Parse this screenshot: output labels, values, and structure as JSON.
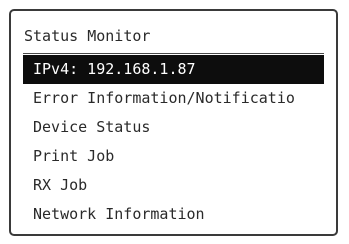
{
  "screen": {
    "title": "Status Monitor",
    "menu": [
      {
        "label": "IPv4: 192.168.1.87",
        "selected": true
      },
      {
        "label": "Error Information/Notificatio",
        "selected": false
      },
      {
        "label": "Device Status",
        "selected": false
      },
      {
        "label": "Print Job",
        "selected": false
      },
      {
        "label": "RX Job",
        "selected": false
      },
      {
        "label": "Network Information",
        "selected": false
      }
    ]
  }
}
